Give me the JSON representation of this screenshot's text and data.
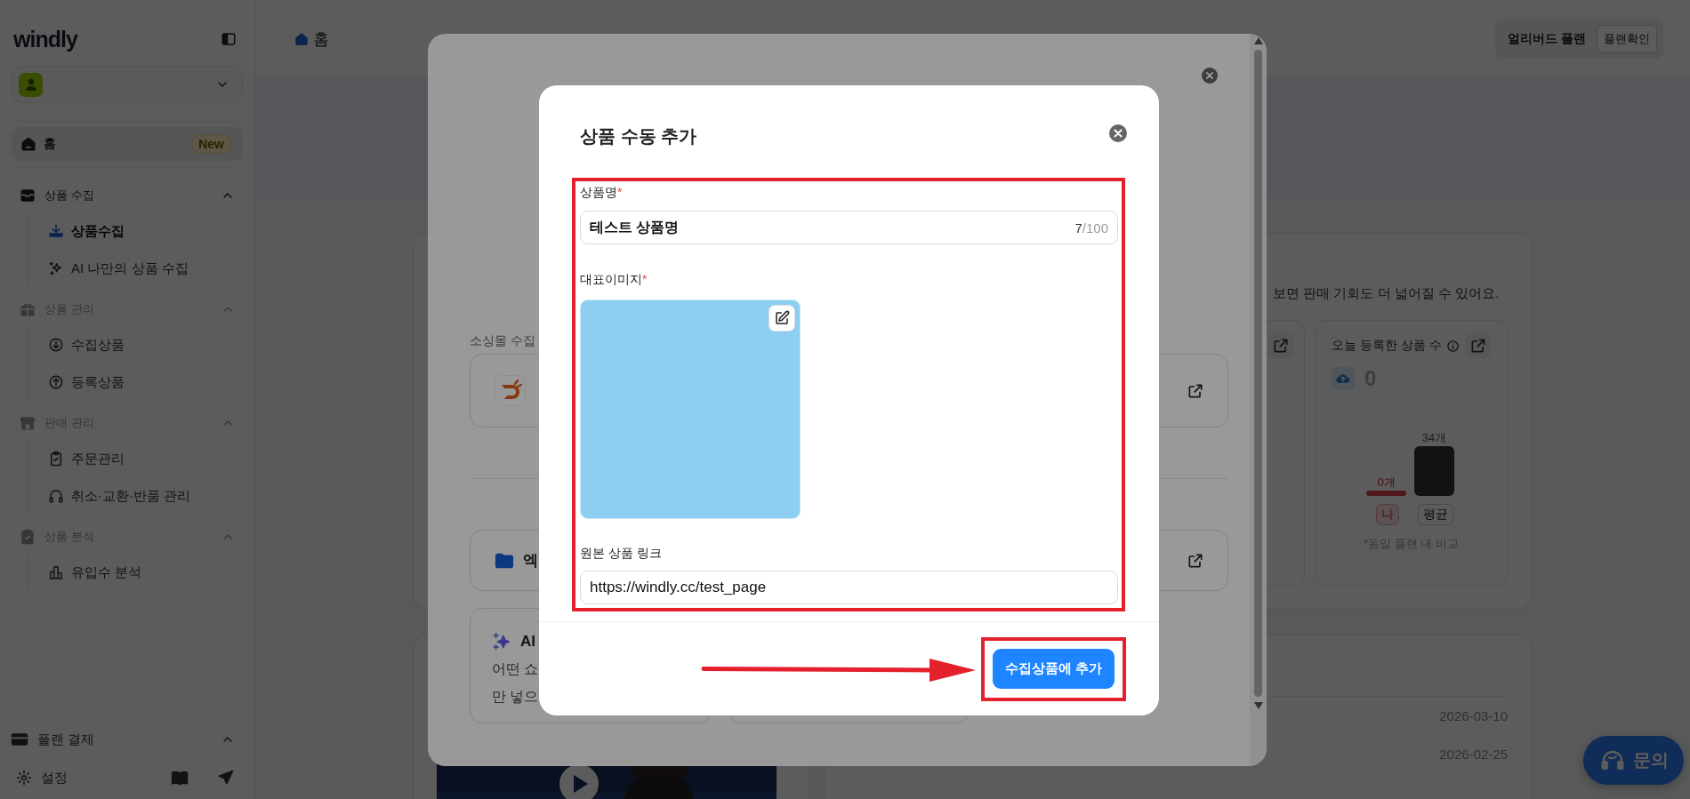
{
  "sidebar": {
    "logo": "windly",
    "home": {
      "label": "홈",
      "badge": "New",
      "selected": true
    },
    "sections": [
      {
        "label": "상품 수집",
        "active": true,
        "expanded": true,
        "items": [
          {
            "label": "상품수집",
            "selected": true
          },
          {
            "label": "AI 나만의 상품 수집",
            "selected": false
          }
        ]
      },
      {
        "label": "상품 관리",
        "active": false,
        "expanded": true,
        "items": [
          {
            "label": "수집상품",
            "selected": false
          },
          {
            "label": "등록상품",
            "selected": false
          }
        ]
      },
      {
        "label": "판매 관리",
        "active": false,
        "expanded": true,
        "items": [
          {
            "label": "주문관리",
            "selected": false
          },
          {
            "label": "취소·교환·반품 관리",
            "selected": false
          }
        ]
      },
      {
        "label": "상품 분석",
        "active": false,
        "expanded": true,
        "items": [
          {
            "label": "유입수 분석",
            "selected": false
          }
        ]
      }
    ],
    "billing": {
      "label": "플랜 결제"
    },
    "settings": {
      "label": "설정"
    }
  },
  "header": {
    "title": "홈",
    "plan": "얼리버드 플랜",
    "plan_button": "플랜확인"
  },
  "dashboard": {
    "notice_snippet": "보면 판매 기회도 더 넓어질 수 있어요.",
    "stat_card": {
      "title": "오늘 등록한 상품 수",
      "value": "0",
      "note": "*동일 플랜 내 비교",
      "chart_data": {
        "type": "bar",
        "categories": [
          "나",
          "평균"
        ],
        "values": [
          0,
          34
        ],
        "value_labels": [
          "0개",
          "34개"
        ]
      }
    },
    "dates": [
      "2026-03-10",
      "2026-02-25"
    ]
  },
  "chat_button": "문의",
  "outer_modal": {
    "section_label": "소싱몰 수집",
    "excel_card": "엑",
    "ai_card": {
      "title": "AI",
      "lines": [
        "어떤 쇼",
        "만 넣으"
      ]
    }
  },
  "dialog": {
    "title": "상품 수동 추가",
    "fields": [
      {
        "kind": "text",
        "label": "상품명",
        "required_mark": "*",
        "value": "테스트 상품명",
        "count": "7",
        "limit": "/100"
      },
      {
        "label": "대표이미지",
        "required_mark": "*"
      },
      {
        "kind": "text",
        "label": "원본 상품 링크",
        "value": "https://windly.cc/test_page"
      }
    ],
    "submit": "수집상품에 추가"
  }
}
